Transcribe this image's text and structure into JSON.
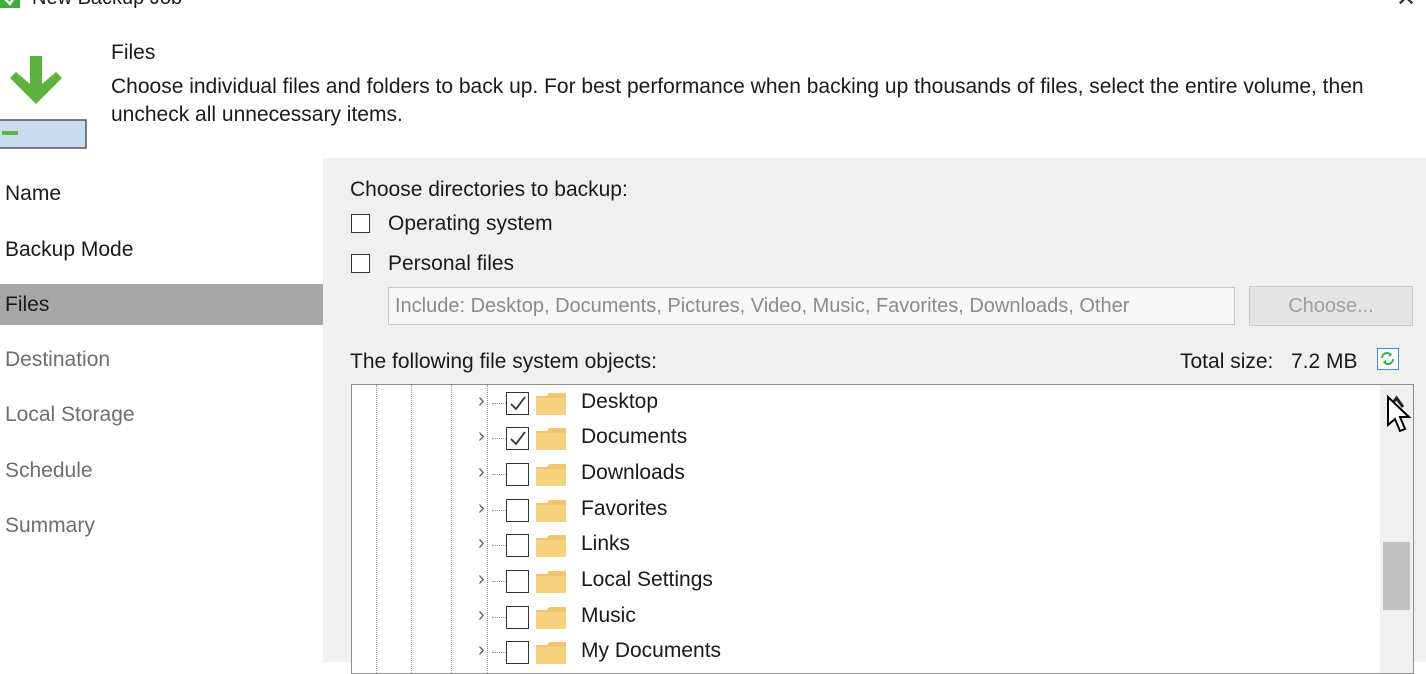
{
  "window": {
    "title": "New Backup Job",
    "close_glyph": "✕"
  },
  "header": {
    "title": "Files",
    "description": "Choose individual files and folders to back up. For best performance when backing up thousands of files, select the entire volume, then uncheck all unnecessary items."
  },
  "sidebar": {
    "items": [
      {
        "label": "Name",
        "state": "done"
      },
      {
        "label": "Backup Mode",
        "state": "done"
      },
      {
        "label": "Files",
        "state": "active"
      },
      {
        "label": "Destination",
        "state": "todo"
      },
      {
        "label": "Local Storage",
        "state": "todo"
      },
      {
        "label": "Schedule",
        "state": "todo"
      },
      {
        "label": "Summary",
        "state": "todo"
      }
    ]
  },
  "content": {
    "choose_label": "Choose directories to backup:",
    "operating_system": {
      "label": "Operating system",
      "checked": false
    },
    "personal_files": {
      "label": "Personal files",
      "checked": false
    },
    "include_field": "Include: Desktop, Documents, Pictures, Video, Music, Favorites, Downloads, Other",
    "choose_button": "Choose...",
    "objects_label": "The following file system objects:",
    "total_size_label": "Total size:",
    "total_size_value": "7.2 MB",
    "tree": [
      {
        "name": "Desktop",
        "checked": true
      },
      {
        "name": "Documents",
        "checked": true
      },
      {
        "name": "Downloads",
        "checked": false
      },
      {
        "name": "Favorites",
        "checked": false
      },
      {
        "name": "Links",
        "checked": false
      },
      {
        "name": "Local Settings",
        "checked": false
      },
      {
        "name": "Music",
        "checked": false
      },
      {
        "name": "My Documents",
        "checked": false
      }
    ]
  },
  "colors": {
    "accent_green": "#3cb043",
    "folder_yellow": "#f2c46d",
    "active_item_bg": "#a6a6a6",
    "content_bg": "#f0f0f0"
  },
  "icons": {
    "app": "backup-app-icon",
    "header": "backup-download-icon",
    "folder": "folder-icon",
    "refresh": "refresh-icon",
    "expand": "chevron-right-icon"
  }
}
